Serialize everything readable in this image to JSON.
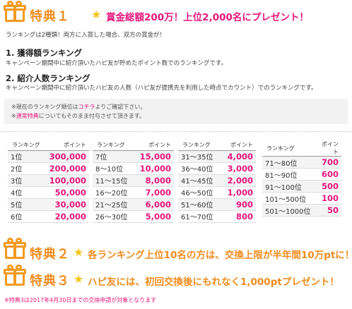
{
  "tokuten1": {
    "title": "特典１",
    "headline": "賞金総額200万！上位2,000名にプレゼント！",
    "intro": "ランキングは2種類！両方に入賞した場合、双方の賞金が！",
    "ranking1_title": "1. 獲得額ランキング",
    "ranking1_desc": "キャンペーン期間中に紹介頂いたハピ友が貯めたポイント数でのランキングです。",
    "ranking2_title": "2. 紹介人数ランキング",
    "ranking2_desc": "キャンペーン期間中に紹介頂いたハピ友の人数（ハピ友が提携先を利用した時点でカウント）でのランキングです。",
    "note1_prefix": "※現在のランキング順位は",
    "note1_link": "コチラ",
    "note1_suffix": "よりご確認下さい。",
    "note2_prefix": "※",
    "note2_link": "通常特典",
    "note2_suffix": "についてもそのまま付与させて頂きます。"
  },
  "table": {
    "header_rank": "ランキング",
    "header_points": "ポイント",
    "columns": [
      [
        {
          "rank": "1位",
          "points": "300,000"
        },
        {
          "rank": "2位",
          "points": "200,000"
        },
        {
          "rank": "3位",
          "points": "100,000"
        },
        {
          "rank": "4位",
          "points": "50,000"
        },
        {
          "rank": "5位",
          "points": "30,000"
        },
        {
          "rank": "6位",
          "points": "20,000"
        }
      ],
      [
        {
          "rank": "7位",
          "points": "15,000"
        },
        {
          "rank": "8〜10位",
          "points": "10,000"
        },
        {
          "rank": "11〜15位",
          "points": "8,000"
        },
        {
          "rank": "16〜20位",
          "points": "7,000"
        },
        {
          "rank": "21〜25位",
          "points": "6,000"
        },
        {
          "rank": "26〜30位",
          "points": "5,000"
        }
      ],
      [
        {
          "rank": "31〜35位",
          "points": "4,000"
        },
        {
          "rank": "36〜40位",
          "points": "3,000"
        },
        {
          "rank": "41〜45位",
          "points": "2,000"
        },
        {
          "rank": "46〜50位",
          "points": "1,000"
        },
        {
          "rank": "51〜60位",
          "points": "900"
        },
        {
          "rank": "61〜70位",
          "points": "800"
        }
      ],
      [
        {
          "rank": "71〜80位",
          "points": "700"
        },
        {
          "rank": "81〜90位",
          "points": "600"
        },
        {
          "rank": "91〜100位",
          "points": "500"
        },
        {
          "rank": "101〜500位",
          "points": "100"
        },
        {
          "rank": "501〜1000位",
          "points": "50"
        }
      ]
    ]
  },
  "tokuten2": {
    "title": "特典２",
    "headline": "各ランキング上位10名の方は、交換上限が半年間10万ptに！"
  },
  "tokuten3": {
    "title": "特典３",
    "headline": "ハピ友には、初回交換後にもれなく1,000ptプレゼント！",
    "footnote": "※特典3は2017年4月30日までの交換申請が対象となります"
  },
  "colors": {
    "accent_orange": "#f08c1e",
    "accent_pink": "#e8177d",
    "star_yellow": "#f5c518"
  }
}
